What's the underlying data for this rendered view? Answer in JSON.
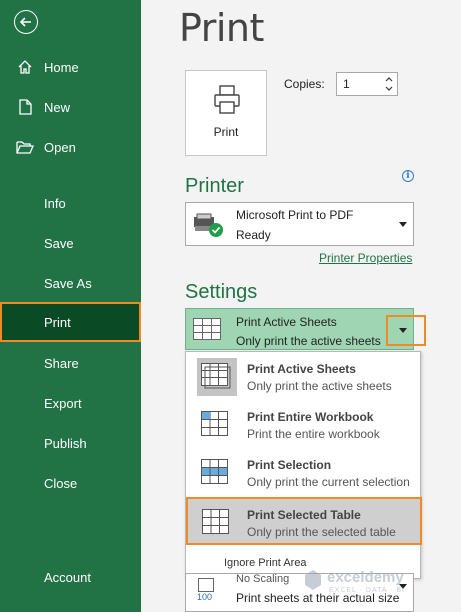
{
  "sidebar": {
    "items": [
      {
        "label": "Home",
        "icon": "home-icon"
      },
      {
        "label": "New",
        "icon": "new-file-icon"
      },
      {
        "label": "Open",
        "icon": "folder-open-icon"
      },
      {
        "label": "Info"
      },
      {
        "label": "Save"
      },
      {
        "label": "Save As"
      },
      {
        "label": "Print",
        "selected": true
      },
      {
        "label": "Share"
      },
      {
        "label": "Export"
      },
      {
        "label": "Publish"
      },
      {
        "label": "Close"
      },
      {
        "label": "Account"
      }
    ]
  },
  "main": {
    "title": "Print",
    "print_button_label": "Print",
    "copies_label": "Copies:",
    "copies_value": "1",
    "printer": {
      "heading": "Printer",
      "name": "Microsoft Print to PDF",
      "status": "Ready",
      "properties_link": "Printer Properties"
    },
    "settings": {
      "heading": "Settings",
      "selected_title": "Print Active Sheets",
      "selected_desc": "Only print the active sheets",
      "options": [
        {
          "title": "Print Active Sheets",
          "desc": "Only print the active sheets"
        },
        {
          "title": "Print Entire Workbook",
          "desc": "Print the entire workbook"
        },
        {
          "title": "Print Selection",
          "desc": "Only print the current selection"
        },
        {
          "title": "Print Selected Table",
          "desc": "Only print the selected table"
        }
      ],
      "ignore_print_area": "Ignore Print Area"
    },
    "scaling": {
      "title": "No Scaling",
      "desc": "Print sheets at their actual size",
      "icon_number": "100"
    }
  },
  "watermark": {
    "name": "exceldemy",
    "tagline": "EXCEL · DATA · BI"
  },
  "colors": {
    "sidebar_bg": "#217346",
    "selected_bg": "#0a4a24",
    "highlight_border": "#f08a24",
    "accent": "#217346"
  }
}
